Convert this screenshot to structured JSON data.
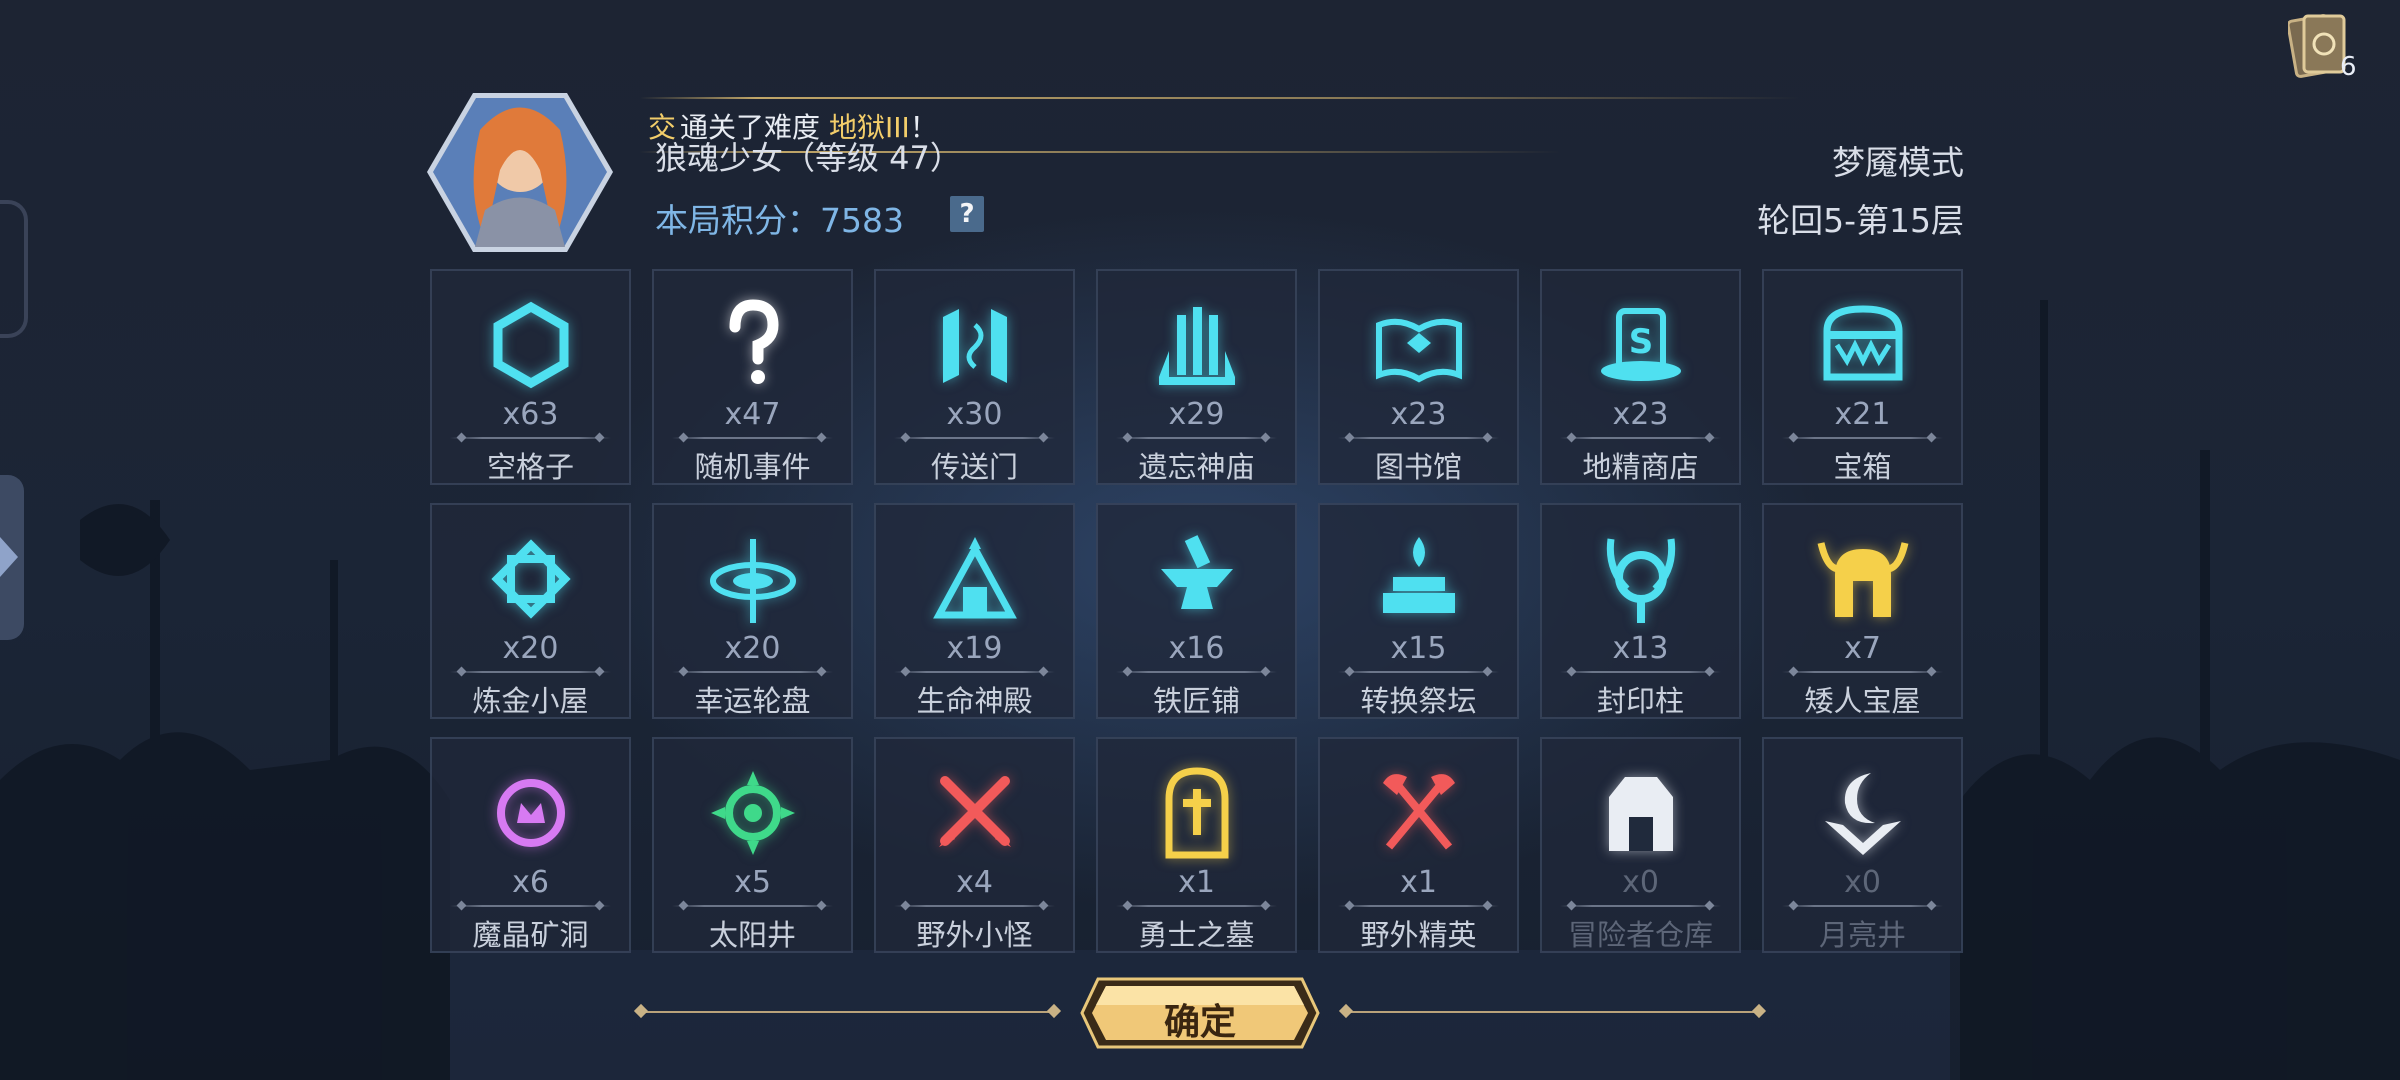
{
  "top_right": {
    "card_count": "6"
  },
  "header": {
    "notice_mark": "交",
    "notice_prefix": "通关了难度",
    "difficulty": "地狱III",
    "notice_suffix": "！",
    "player": "狼魂少女（等级 47）",
    "score_label": "本局积分：",
    "score_value": "7583",
    "help_label": "?",
    "mode": "梦魇模式",
    "round": "轮回5-第15层"
  },
  "tiles": [
    {
      "name": "空格子",
      "count": "x63",
      "icon": "hexagon-icon",
      "color": "#4fe0f0"
    },
    {
      "name": "随机事件",
      "count": "x47",
      "icon": "question-mark-icon",
      "color": "#ffffff"
    },
    {
      "name": "传送门",
      "count": "x30",
      "icon": "portal-icon",
      "color": "#4fe0f0"
    },
    {
      "name": "遗忘神庙",
      "count": "x29",
      "icon": "temple-icon",
      "color": "#4fe0f0"
    },
    {
      "name": "图书馆",
      "count": "x23",
      "icon": "open-book-icon",
      "color": "#4fe0f0"
    },
    {
      "name": "地精商店",
      "count": "x23",
      "icon": "shop-hat-icon",
      "color": "#4fe0f0"
    },
    {
      "name": "宝箱",
      "count": "x21",
      "icon": "treasure-chest-icon",
      "color": "#4fe0f0"
    },
    {
      "name": "炼金小屋",
      "count": "x20",
      "icon": "alchemy-icon",
      "color": "#4fe0f0"
    },
    {
      "name": "幸运轮盘",
      "count": "x20",
      "icon": "wheel-icon",
      "color": "#4fe0f0"
    },
    {
      "name": "生命神殿",
      "count": "x19",
      "icon": "life-temple-icon",
      "color": "#4fe0f0"
    },
    {
      "name": "铁匠铺",
      "count": "x16",
      "icon": "anvil-icon",
      "color": "#4fe0f0"
    },
    {
      "name": "转换祭坛",
      "count": "x15",
      "icon": "altar-icon",
      "color": "#4fe0f0"
    },
    {
      "name": "封印柱",
      "count": "x13",
      "icon": "seal-pillar-icon",
      "color": "#4fe0f0"
    },
    {
      "name": "矮人宝屋",
      "count": "x7",
      "icon": "dwarf-helmet-icon",
      "color": "#f5d04a"
    },
    {
      "name": "魔晶矿洞",
      "count": "x6",
      "icon": "crystal-mine-icon",
      "color": "#d77af2"
    },
    {
      "name": "太阳井",
      "count": "x5",
      "icon": "sun-well-icon",
      "color": "#3fd98a"
    },
    {
      "name": "野外小怪",
      "count": "x4",
      "icon": "crossed-swords-icon",
      "color": "#f25a5a"
    },
    {
      "name": "勇士之墓",
      "count": "x1",
      "icon": "tombstone-icon",
      "color": "#f5d04a"
    },
    {
      "name": "野外精英",
      "count": "x1",
      "icon": "crossed-axes-icon",
      "color": "#f25a5a"
    },
    {
      "name": "冒险者仓库",
      "count": "x0",
      "icon": "warehouse-icon",
      "color": "#e9edf3"
    },
    {
      "name": "月亮井",
      "count": "x0",
      "icon": "moon-well-icon",
      "color": "#e9edf3"
    }
  ],
  "footer": {
    "confirm_label": "确定"
  }
}
